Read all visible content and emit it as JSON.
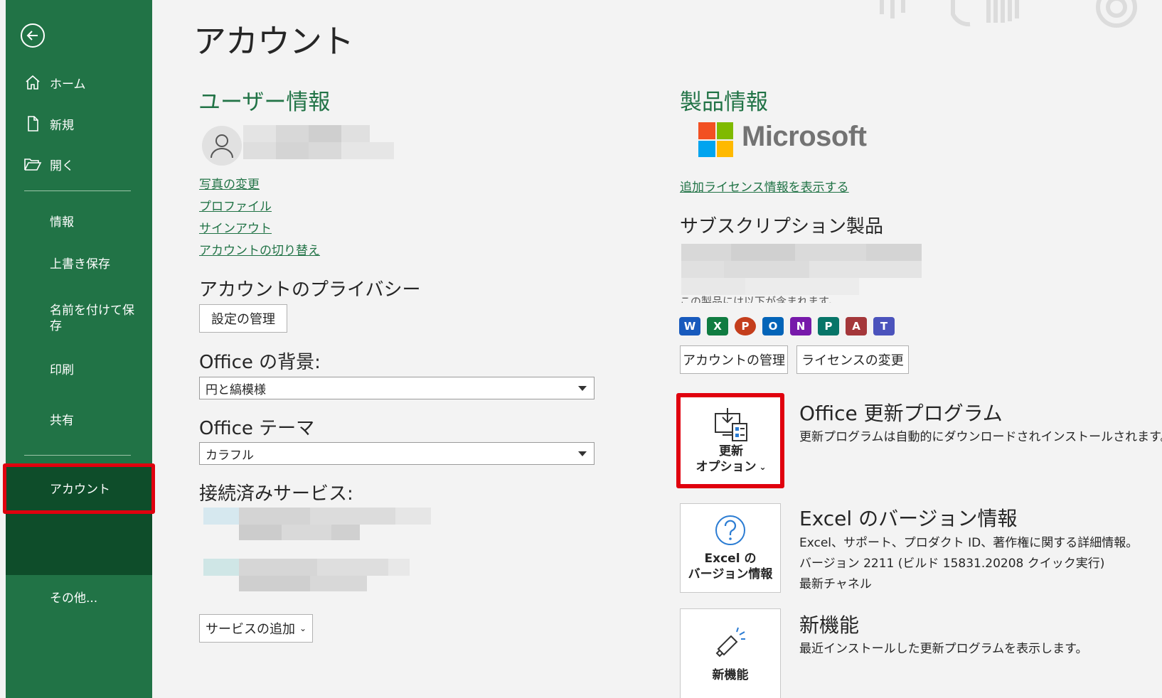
{
  "sidebar": {
    "back_label": "",
    "items": [
      {
        "label": "ホーム",
        "icon": "home-icon"
      },
      {
        "label": "新規",
        "icon": "new-document-icon"
      },
      {
        "label": "開く",
        "icon": "open-folder-icon"
      },
      {
        "label": "情報"
      },
      {
        "label": "上書き保存"
      },
      {
        "label": "名前を付けて保存"
      },
      {
        "label": "印刷"
      },
      {
        "label": "共有"
      },
      {
        "label": "アカウント"
      },
      {
        "label": "その他..."
      }
    ]
  },
  "page": {
    "title": "アカウント"
  },
  "user_info": {
    "title": "ユーザー情報",
    "links": [
      "写真の変更",
      "プロファイル",
      "サインアウト",
      "アカウントの切り替え"
    ]
  },
  "privacy": {
    "title": "アカウントのプライバシー",
    "button": "設定の管理"
  },
  "background": {
    "title": "Office の背景:",
    "value": "円と縞模様"
  },
  "theme": {
    "title": "Office テーマ",
    "value": "カラフル"
  },
  "services": {
    "title": "接続済みサービス:",
    "add_button": "サービスの追加"
  },
  "product": {
    "title": "製品情報",
    "brand": "Microsoft",
    "license_link": "追加ライセンス情報を表示する",
    "subscription_title": "サブスクリプション製品",
    "contains_text": "この製品には以下が含まれます。",
    "apps": [
      {
        "letter": "W",
        "color": "#185abd",
        "icon": "word-icon"
      },
      {
        "letter": "X",
        "color": "#107c41",
        "icon": "excel-icon"
      },
      {
        "letter": "P",
        "color": "#c43e1c",
        "icon": "powerpoint-icon"
      },
      {
        "letter": "O",
        "color": "#0364b8",
        "icon": "outlook-icon"
      },
      {
        "letter": "N",
        "color": "#7719aa",
        "icon": "onenote-icon"
      },
      {
        "letter": "P",
        "color": "#077568",
        "icon": "publisher-icon"
      },
      {
        "letter": "A",
        "color": "#a4373a",
        "icon": "access-icon"
      },
      {
        "letter": "T",
        "color": "#4b53bc",
        "icon": "teams-icon"
      }
    ],
    "manage_account_button": "アカウントの管理",
    "change_license_button": "ライセンスの変更"
  },
  "updates": {
    "tile_line1": "更新",
    "tile_line2": "オプション",
    "title": "Office 更新プログラム",
    "desc": "更新プログラムは自動的にダウンロードされインストールされます。"
  },
  "about": {
    "tile_line1": "Excel の",
    "tile_line2": "バージョン情報",
    "title": "Excel のバージョン情報",
    "line1": "Excel、サポート、プロダクト ID、著作権に関する詳細情報。",
    "line2": "バージョン 2211 (ビルド 15831.20208 クイック実行)",
    "line3": "最新チャネル"
  },
  "whatsnew": {
    "tile_label": "新機能",
    "title": "新機能",
    "desc": "最近インストールした更新プログラムを表示します。"
  },
  "colors": {
    "accent": "#217346",
    "active": "#0e4d2a",
    "highlight": "#e0000e"
  }
}
